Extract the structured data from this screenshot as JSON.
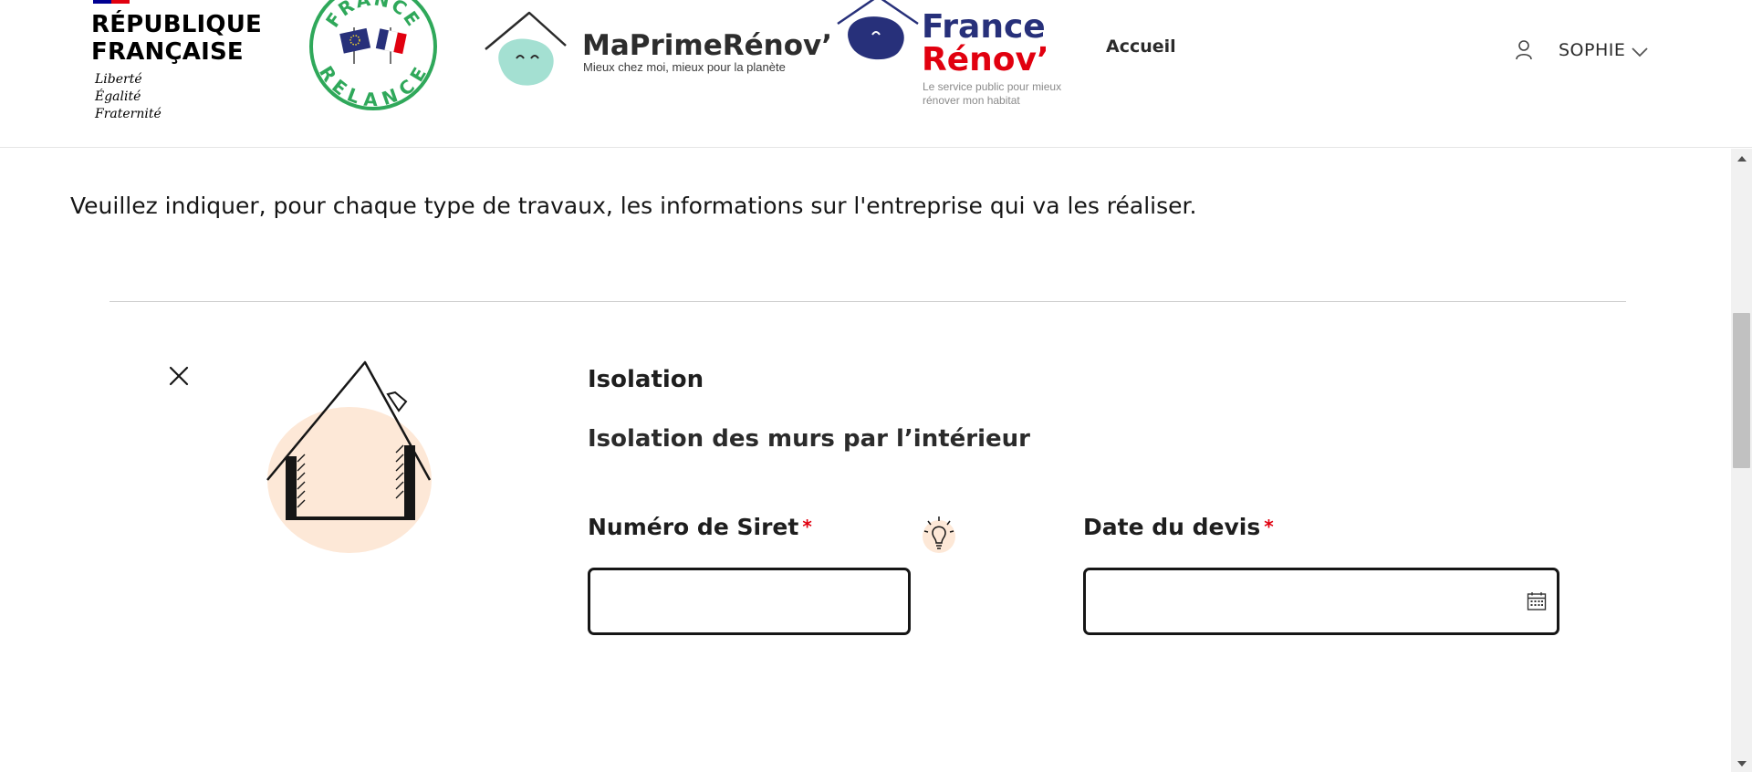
{
  "header": {
    "republique": {
      "title": "RÉPUBLIQUE\nFRANÇAISE",
      "motto": "Liberté\nÉgalité\nFraternité"
    },
    "relance_logo": {
      "top_text": "FRANCE",
      "bottom_text": "RELANCE",
      "color": "#2fa85a"
    },
    "maprimerenov": {
      "name": "MaPrimeRénov’",
      "tagline": "Mieux chez moi, mieux pour la planète",
      "accent": "#a4e0d2"
    },
    "france_renov": {
      "line1": "France",
      "line2": "Rénov’",
      "tagline": "Le service public pour mieux rénover mon habitat",
      "blue": "#27307a",
      "red": "#e1000f"
    },
    "nav": {
      "home": "Accueil"
    },
    "user": {
      "name": "SOPHIE",
      "icon": "user-icon",
      "menu_icon": "chevron-down-icon"
    }
  },
  "content": {
    "intro": "Veuillez indiquer, pour chaque type de travaux, les informations sur l'entreprise qui va les réaliser.",
    "work_item": {
      "category": "Isolation",
      "subcategory": "Isolation des murs par l’intérieur",
      "illustration_icon": "house-insulation-icon",
      "fields": {
        "siret": {
          "label": "Numéro de Siret",
          "required_mark": "*",
          "value": "",
          "help_icon": "lightbulb-icon"
        },
        "quote_date": {
          "label": "Date du devis",
          "required_mark": "*",
          "value": "",
          "icon": "calendar-icon"
        }
      }
    }
  },
  "colors": {
    "required": "#e1000f",
    "border": "#161616",
    "divider": "#cccccc",
    "house_bg": "#fde8d7"
  }
}
